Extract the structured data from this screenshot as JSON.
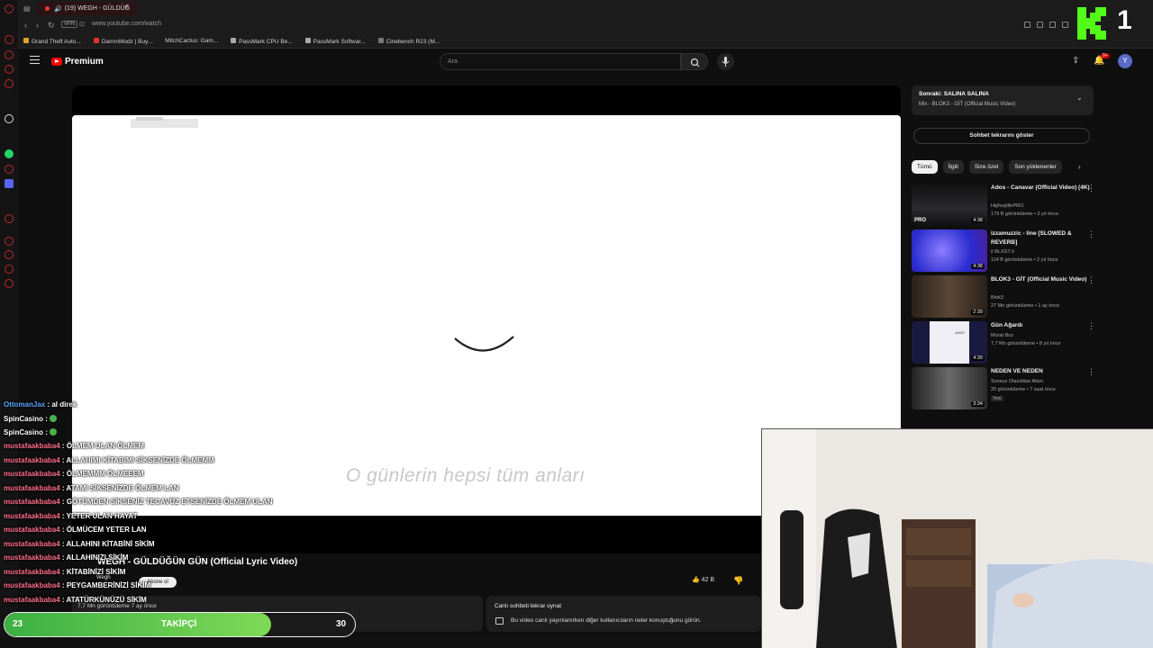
{
  "browser": {
    "tab_title": "(19) WEGH - GÜLDÜĞ",
    "url": "www.youtube.com/watch",
    "vpn_label": "VPN",
    "bookmarks": [
      "Grand Theft Auto...",
      "DammModz | Buy...",
      "MitchCactus: Gam...",
      "PassMark CPU Be...",
      "PassMark Softwar...",
      "Cinebench R23 (M..."
    ]
  },
  "youtube": {
    "brand": "Premium",
    "search_placeholder": "Ara",
    "notification_count": "9+",
    "avatar_letter": "Y"
  },
  "video": {
    "lyric": "O günlerin hepsi tüm anları",
    "title": "WEGH - GÜLDÜĞÜN GÜN (Official Lyric Video)",
    "channel": "Wegh",
    "join_label": "Abone ol",
    "likes": "42 B",
    "stats": "7,7 Mn görüntüleme  7 ay önce"
  },
  "chat_replay": {
    "title": "Canlı sohbeti tekrar oynat",
    "desc": "Bu video canlı yayınlanırken diğer kullanıcıların neler konuştuğunu görün."
  },
  "sidebar": {
    "upnext_title": "Sonraki: SALINA SALINA",
    "upnext_sub": "Mix - BLOK3 - GİT (Official Music Video)",
    "show_chat": "Sohbet tekrarını göster",
    "chips": [
      "Tümü",
      "İlgili",
      "Size özel",
      "Son yüklenenler"
    ],
    "recs": [
      {
        "title": "Ados - Canavar (Official Video) (4K)",
        "channel": "HiphoplifePRO",
        "meta": "179 B görüntüleme • 2 yıl önce",
        "duration": "4:38",
        "thumb_text": "PRO",
        "color": "#1e1e22"
      },
      {
        "title": "izzamuzzic - line [SLOWED & REVERB]",
        "channel": "♯ BLXST ♯",
        "meta": "114 B görüntüleme • 2 yıl önce",
        "duration": "4:38",
        "thumb_text": "",
        "color": "#3a3bd0"
      },
      {
        "title": "BLOK3 - GİT (Official Music Video)",
        "channel": "Blok3",
        "meta": "27 Mn görüntüleme • 1 ay önce",
        "duration": "2:39",
        "thumb_text": "",
        "color": "#3b2e24"
      },
      {
        "title": "Gün Ağardı",
        "channel": "Murat Boz",
        "meta": "7,7 Mn görüntüleme • 8 yıl önce",
        "duration": "4:39",
        "thumb_text": "JANTİ",
        "color": "#e9e9ef"
      },
      {
        "title": "NEDEN VE NEDEN",
        "channel": "Sonsuz Olasılıklar Alanı",
        "meta": "20 görüntüleme • 7 saat önce",
        "duration": "3:34",
        "thumb_text": "",
        "color": "#4a4a4a",
        "badge": "Yeni"
      }
    ]
  },
  "chat": [
    {
      "user": "OttomanJax",
      "msg": "al direk",
      "color": "blue"
    },
    {
      "user": "SpinCasino",
      "msg": "",
      "color": "white",
      "emote": true
    },
    {
      "user": "SpinCasino",
      "msg": "",
      "color": "white",
      "emote": true
    },
    {
      "user": "mustafaakbaba4",
      "msg": "ÖLMEM ULAN ÖLMEM"
    },
    {
      "user": "mustafaakbaba4",
      "msg": "ALLAHIMI KİTABIMI SİKSENİZDE ÖLMEMM"
    },
    {
      "user": "mustafaakbaba4",
      "msg": "ÖLMEMMM ÖLMEEEM"
    },
    {
      "user": "mustafaakbaba4",
      "msg": "ATAMI SİKSENİZDE ÖLMEM LAN"
    },
    {
      "user": "mustafaakbaba4",
      "msg": "GÖTÜMDEN SİKSENİZ TECAVÜZ ETSENİZDE ÖLMEM ULAN"
    },
    {
      "user": "mustafaakbaba4",
      "msg": "YETER ULAN HAYAT"
    },
    {
      "user": "mustafaakbaba4",
      "msg": "ÖLMÜCEM YETER LAN"
    },
    {
      "user": "mustafaakbaba4",
      "msg": "ALLAHINI KİTABİNİ SİKİM"
    },
    {
      "user": "mustafaakbaba4",
      "msg": "ALLAHINIZI SİKİM"
    },
    {
      "user": "mustafaakbaba4",
      "msg": "KİTABİNİZİ SİKİM"
    },
    {
      "user": "mustafaakbaba4",
      "msg": "PEYGAMBERİNİZİ SİKİM"
    },
    {
      "user": "mustafaakbaba4",
      "msg": "ATATÜRKÜNÜZÜ SİKİM"
    }
  ],
  "follower_goal": {
    "current": "23",
    "label": "TAKİPÇİ",
    "goal": "30",
    "progress": 0.76
  },
  "overlay_logo": {
    "number": "1"
  }
}
